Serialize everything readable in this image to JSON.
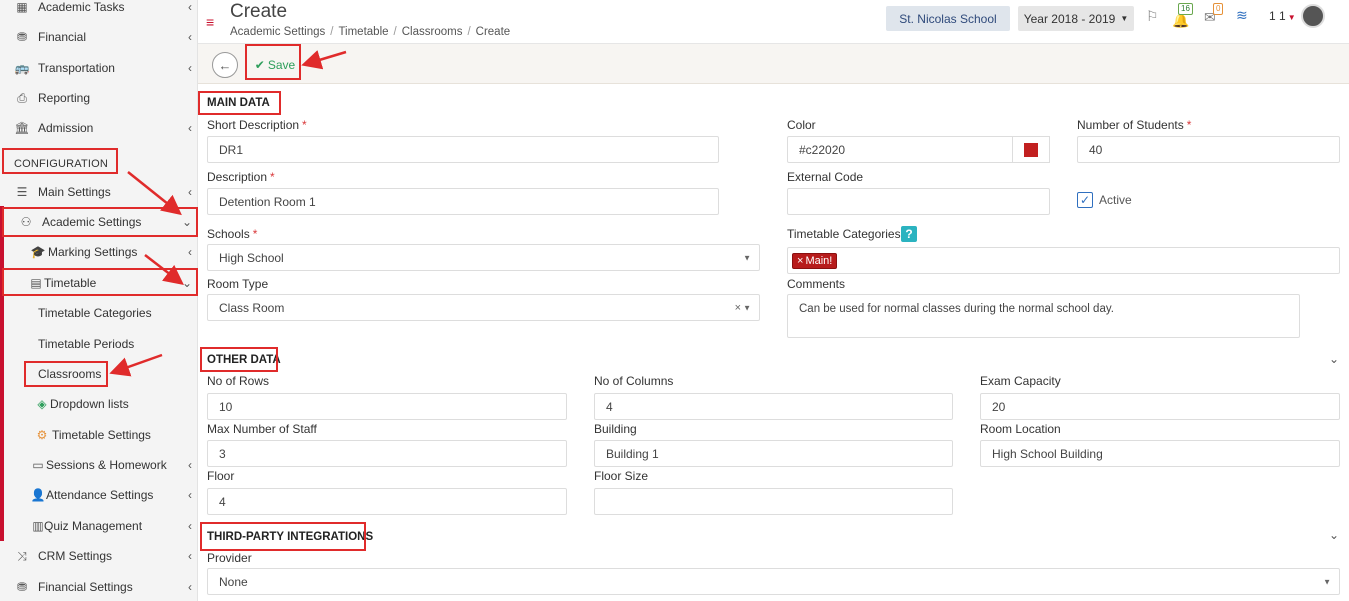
{
  "sidebar": {
    "section_label": "CONFIGURATION",
    "items": [
      {
        "label": "Academic Tasks"
      },
      {
        "label": "Financial"
      },
      {
        "label": "Transportation"
      },
      {
        "label": "Reporting"
      },
      {
        "label": "Admission"
      },
      {
        "label": "Main Settings"
      },
      {
        "label": "Academic Settings"
      },
      {
        "label": "Marking Settings"
      },
      {
        "label": "Timetable"
      },
      {
        "label": "Timetable Categories"
      },
      {
        "label": "Timetable Periods"
      },
      {
        "label": "Classrooms"
      },
      {
        "label": "Dropdown lists"
      },
      {
        "label": "Timetable Settings"
      },
      {
        "label": "Sessions & Homework"
      },
      {
        "label": "Attendance Settings"
      },
      {
        "label": "Quiz Management"
      },
      {
        "label": "CRM Settings"
      },
      {
        "label": "Financial Settings"
      }
    ]
  },
  "header": {
    "title": "Create",
    "breadcrumb": [
      "Academic Settings",
      "Timetable",
      "Classrooms",
      "Create"
    ],
    "school": "St. Nicolas School",
    "year": "Year 2018 - 2019",
    "notifications_count": "16",
    "messages_count": "0",
    "user_number": "1 1"
  },
  "toolbar": {
    "save_label": "Save"
  },
  "main_data": {
    "section_title": "MAIN DATA",
    "short_description_label": "Short Description",
    "short_description_value": "DR1",
    "color_label": "Color",
    "color_value": "#c22020",
    "number_of_students_label": "Number of Students",
    "number_of_students_value": "40",
    "description_label": "Description",
    "description_value": "Detention Room 1",
    "external_code_label": "External Code",
    "external_code_value": "",
    "active_label": "Active",
    "schools_label": "Schools",
    "schools_value": "High School",
    "timetable_categories_label": "Timetable Categories",
    "timetable_category_tag": "Main!",
    "room_type_label": "Room Type",
    "room_type_value": "Class Room",
    "comments_label": "Comments",
    "comments_value": "Can be used for normal classes during the normal school day."
  },
  "other_data": {
    "section_title": "OTHER DATA",
    "rows_label": "No of Rows",
    "rows_value": "10",
    "columns_label": "No of Columns",
    "columns_value": "4",
    "exam_capacity_label": "Exam Capacity",
    "exam_capacity_value": "20",
    "max_staff_label": "Max Number of Staff",
    "max_staff_value": "3",
    "building_label": "Building",
    "building_value": "Building 1",
    "room_location_label": "Room Location",
    "room_location_value": "High School Building",
    "floor_label": "Floor",
    "floor_value": "4",
    "floor_size_label": "Floor Size",
    "floor_size_value": ""
  },
  "integrations": {
    "section_title": "THIRD-PARTY INTEGRATIONS",
    "provider_label": "Provider",
    "provider_value": "None"
  },
  "colors": {
    "accent_red": "#c8102e",
    "save_green": "#2e9e5b",
    "annotation_red": "#e02b2b"
  }
}
